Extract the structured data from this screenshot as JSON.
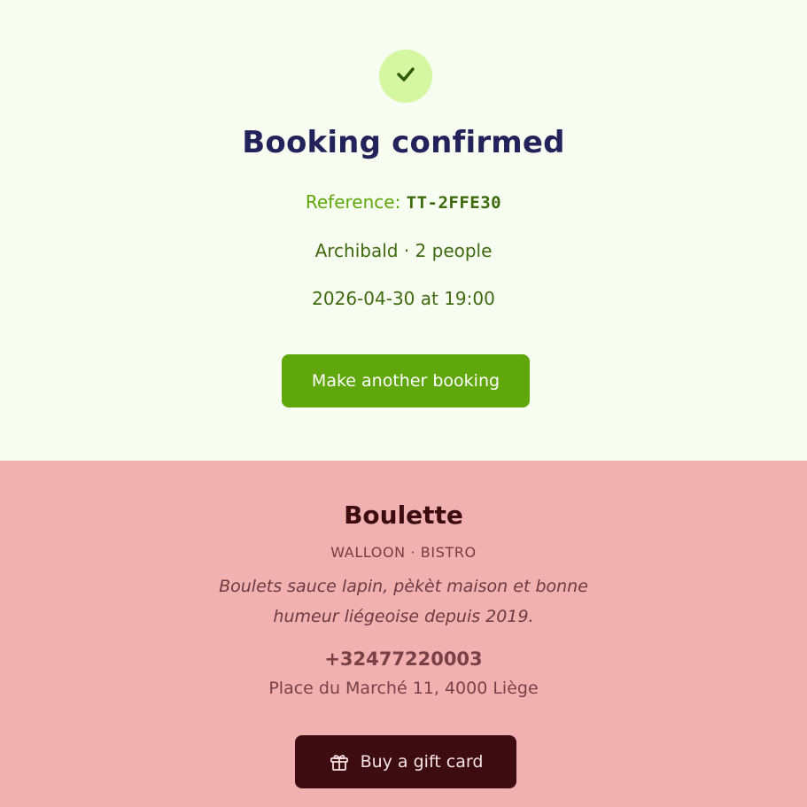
{
  "confirmation": {
    "title": "Booking confirmed",
    "reference_label": "Reference: ",
    "reference_code": "TT-2FFE30",
    "guest_line": "Archibald · 2 people",
    "datetime_line": "2026-04-30 at 19:00",
    "make_another_label": "Make another booking",
    "icon": "check-icon"
  },
  "restaurant": {
    "name": "Boulette",
    "cuisine": "WALLOON · BISTRO",
    "description": "Boulets sauce lapin, pèkèt maison et bonne humeur liégeoise depuis 2019.",
    "phone": "+32477220003",
    "address": "Place du Marché 11, 4000 Liège",
    "gift_card_label": "Buy a gift card",
    "gift_icon": "gift-icon"
  },
  "colors": {
    "top_background": "#f7fdf0",
    "accent_green": "#5fa70a",
    "title_navy": "#24225a",
    "bottom_background": "#f2b1b1",
    "dark_maroon": "#3c0c10"
  }
}
